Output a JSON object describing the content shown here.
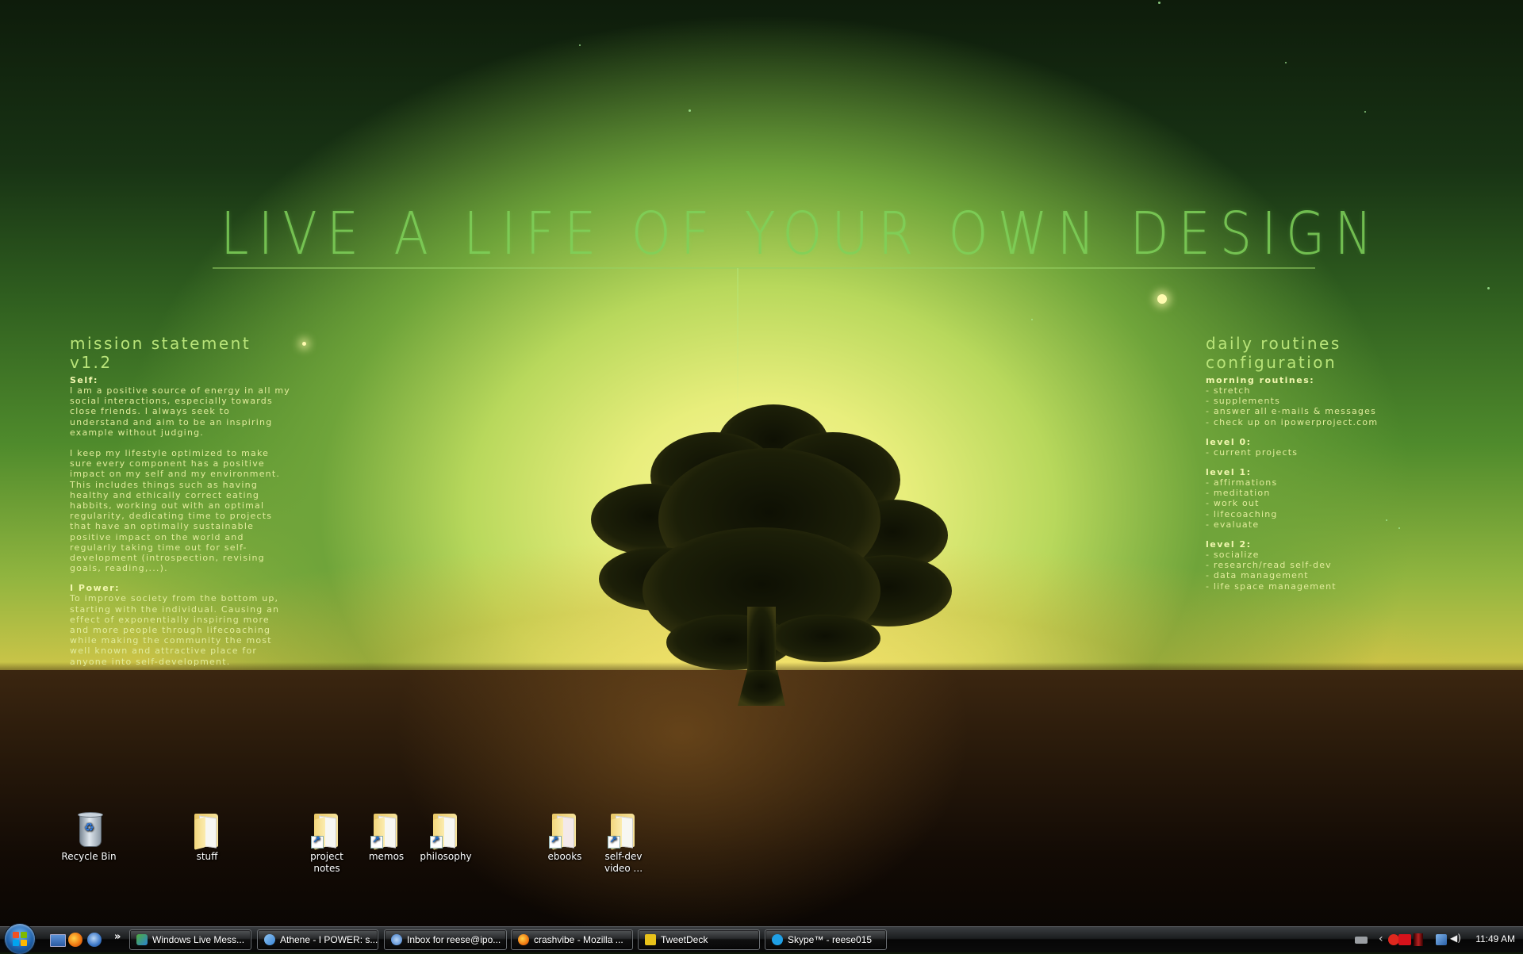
{
  "wallpaper": {
    "headline": "LIVE A LIFE OF YOUR OWN DESIGN",
    "mission": {
      "title": "mission statement v1.2",
      "sections": [
        {
          "heading": "Self:",
          "paragraphs": [
            "I am a positive source of energy in all my social interactions, especially towards close friends. I always seek to understand and aim to be an inspiring example without judging.",
            "I keep my lifestyle optimized to make sure every component has a positive impact on my self and my environment. This includes things such as having healthy and ethically correct eating habbits, working out with an optimal regularity, dedicating time to projects that have an optimally sustainable positive impact on the world and regularly taking time out for self-development (introspection, revising goals, reading,...)."
          ]
        },
        {
          "heading": "I Power:",
          "paragraphs": [
            "To improve society from the bottom up, starting with the individual. Causing an effect of exponentially inspiring more and more people through lifecoaching while making the community the most well known and attractive place for anyone into self-development."
          ]
        }
      ]
    },
    "routines": {
      "title": "daily routines configuration",
      "sections": [
        {
          "heading": "morning routines:",
          "items": [
            "- stretch",
            "- supplements",
            "- answer all e-mails & messages",
            "- check up on ipowerproject.com"
          ]
        },
        {
          "heading": "level 0:",
          "items": [
            "- current projects"
          ]
        },
        {
          "heading": "level 1:",
          "items": [
            "- affirmations",
            "- meditation",
            "- work out",
            "- lifecoaching",
            "- evaluate"
          ]
        },
        {
          "heading": "level 2:",
          "items": [
            "- socialize",
            "- research/read self-dev",
            "- data management",
            "- life space management"
          ]
        }
      ]
    }
  },
  "desktop_icons": [
    {
      "label": "Recycle Bin",
      "icon": "recycle-bin-icon",
      "shortcut": false
    },
    {
      "label": "stuff",
      "icon": "folder-icon",
      "shortcut": false
    },
    {
      "label": "project notes",
      "icon": "folder-icon",
      "shortcut": true
    },
    {
      "label": "memos",
      "icon": "folder-icon",
      "shortcut": true
    },
    {
      "label": "philosophy",
      "icon": "folder-icon",
      "shortcut": true
    },
    {
      "label": "ebooks",
      "icon": "folder-icon",
      "shortcut": true
    },
    {
      "label": "self-dev video ...",
      "icon": "folder-icon",
      "shortcut": true
    }
  ],
  "taskbar": {
    "quick_launch": [
      "show-desktop-icon",
      "firefox-icon",
      "thunderbird-icon"
    ],
    "overflow_label": "»",
    "tasks": [
      {
        "label": "Windows Live Mess...",
        "icon": "windows-live-messenger-icon",
        "color": "#4fae3a"
      },
      {
        "label": "Athene - I POWER: s...",
        "icon": "chat-users-icon",
        "color": "#3a86d6"
      },
      {
        "label": "Inbox for reese@ipo...",
        "icon": "thunderbird-icon",
        "color": "#3c78c8"
      },
      {
        "label": "crashvibe - Mozilla ...",
        "icon": "firefox-icon",
        "color": "#f07a12"
      },
      {
        "label": "TweetDeck",
        "icon": "tweetdeck-icon",
        "color": "#e8c21a"
      },
      {
        "label": "Skype™ - reese015",
        "icon": "skype-icon",
        "color": "#1fa0e6"
      }
    ],
    "tray": {
      "icons": [
        "keyboard-icon",
        "show-hidden-icon",
        "status-icon",
        "ati-icon",
        "meter-icon",
        "network-icon",
        "volume-icon"
      ],
      "clock": "11:49 AM"
    }
  }
}
